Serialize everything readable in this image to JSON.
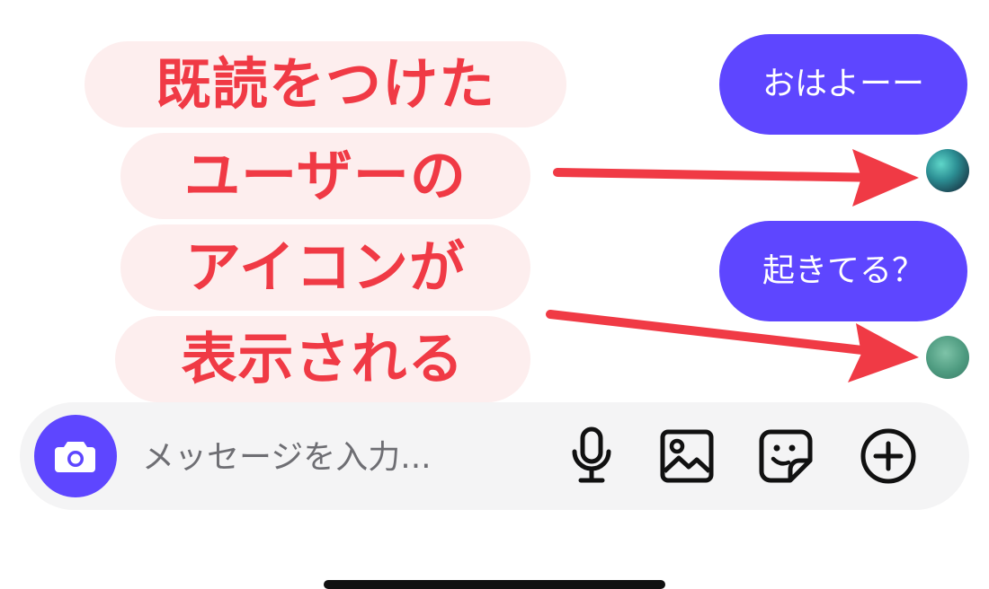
{
  "annotation": {
    "lines": [
      "既読をつけた",
      "ユーザーの",
      "アイコンが",
      "表示される"
    ],
    "color": "#f03a45",
    "background": "#fdeeee"
  },
  "messages": [
    {
      "text": "おはよーー",
      "read_avatar": "teal-abstract-avatar"
    },
    {
      "text": "起きてる？",
      "read_avatar": "green-blurred-avatar"
    }
  ],
  "bubble_color": "#5e46ff",
  "composer": {
    "placeholder": "メッセージを入力...",
    "icons": [
      "camera-icon",
      "microphone-icon",
      "image-icon",
      "sticker-icon",
      "plus-icon"
    ]
  }
}
